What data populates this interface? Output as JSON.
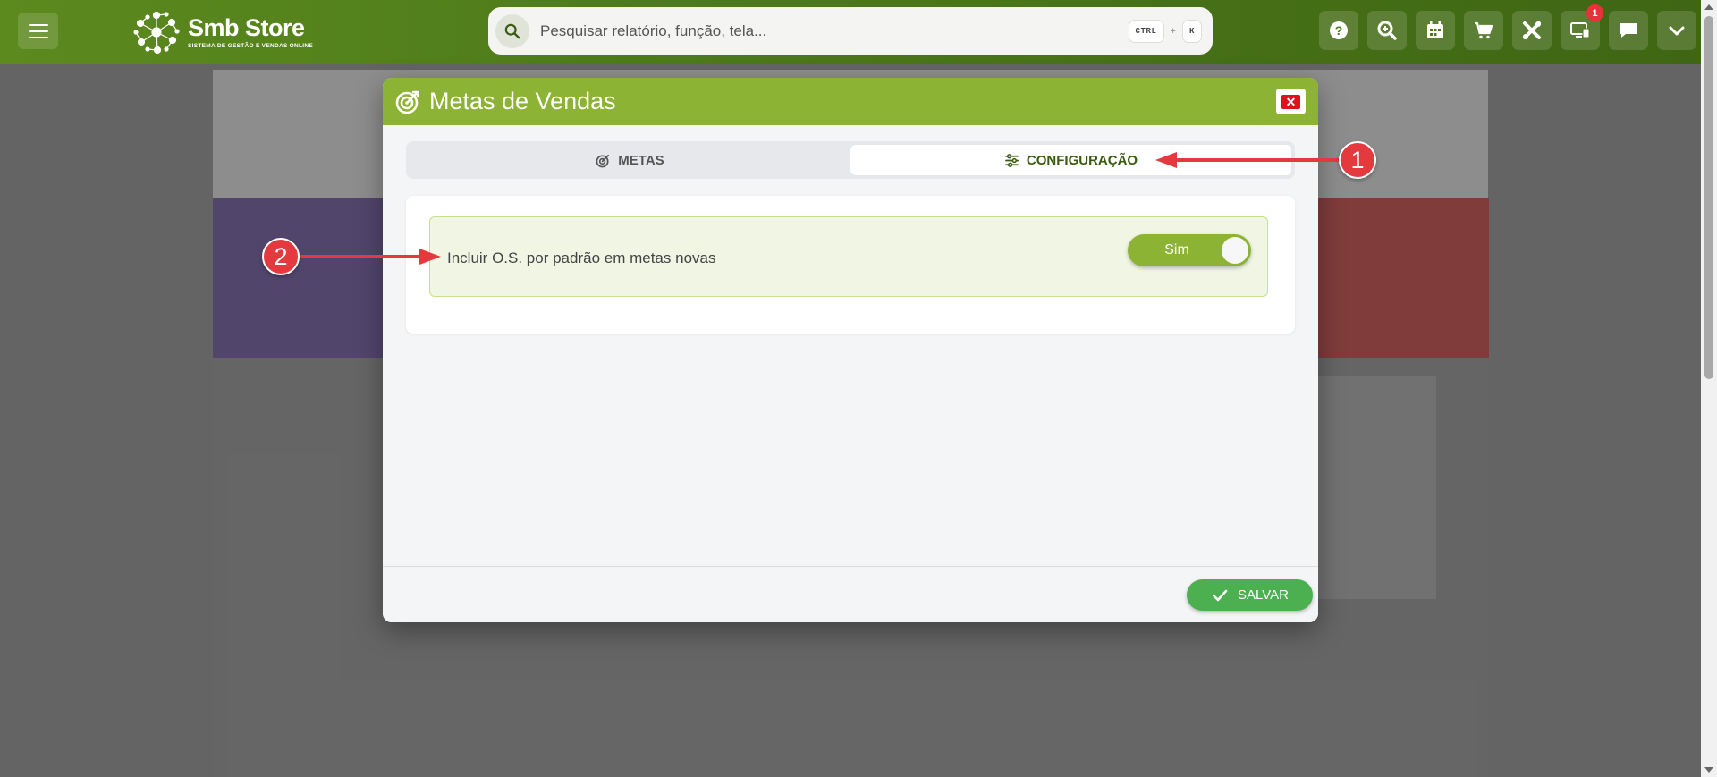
{
  "app": {
    "brand_name": "Smb Store",
    "brand_tagline": "SISTEMA DE GESTÃO E VENDAS ONLINE"
  },
  "search": {
    "placeholder": "Pesquisar relatório, função, tela...",
    "shortcut_key1": "CTRL",
    "shortcut_plus": "+",
    "shortcut_key2": "K"
  },
  "toolbar": {
    "icons": [
      "help-icon",
      "zoom-icon",
      "calendar-icon",
      "cart-icon",
      "tools-icon",
      "monitor-icon",
      "chat-icon",
      "chevron-down-icon"
    ],
    "notification_count": "1"
  },
  "modal": {
    "title": "Metas de Vendas",
    "close_label": "✕",
    "tabs": [
      {
        "label": "METAS",
        "icon": "target-icon",
        "active": false
      },
      {
        "label": "CONFIGURAÇÃO",
        "icon": "sliders-icon",
        "active": true
      }
    ],
    "setting": {
      "label": "Incluir O.S. por padrão em metas novas",
      "toggle_label": "Sim",
      "toggle_on": true
    },
    "save_label": "SALVAR"
  },
  "annotations": [
    "1",
    "2"
  ],
  "colors": {
    "topbar": "#4d7a1a",
    "modal_header": "#8db334",
    "save_button": "#4caf50",
    "callout": "#e4393f",
    "close_button": "#e0101d"
  }
}
